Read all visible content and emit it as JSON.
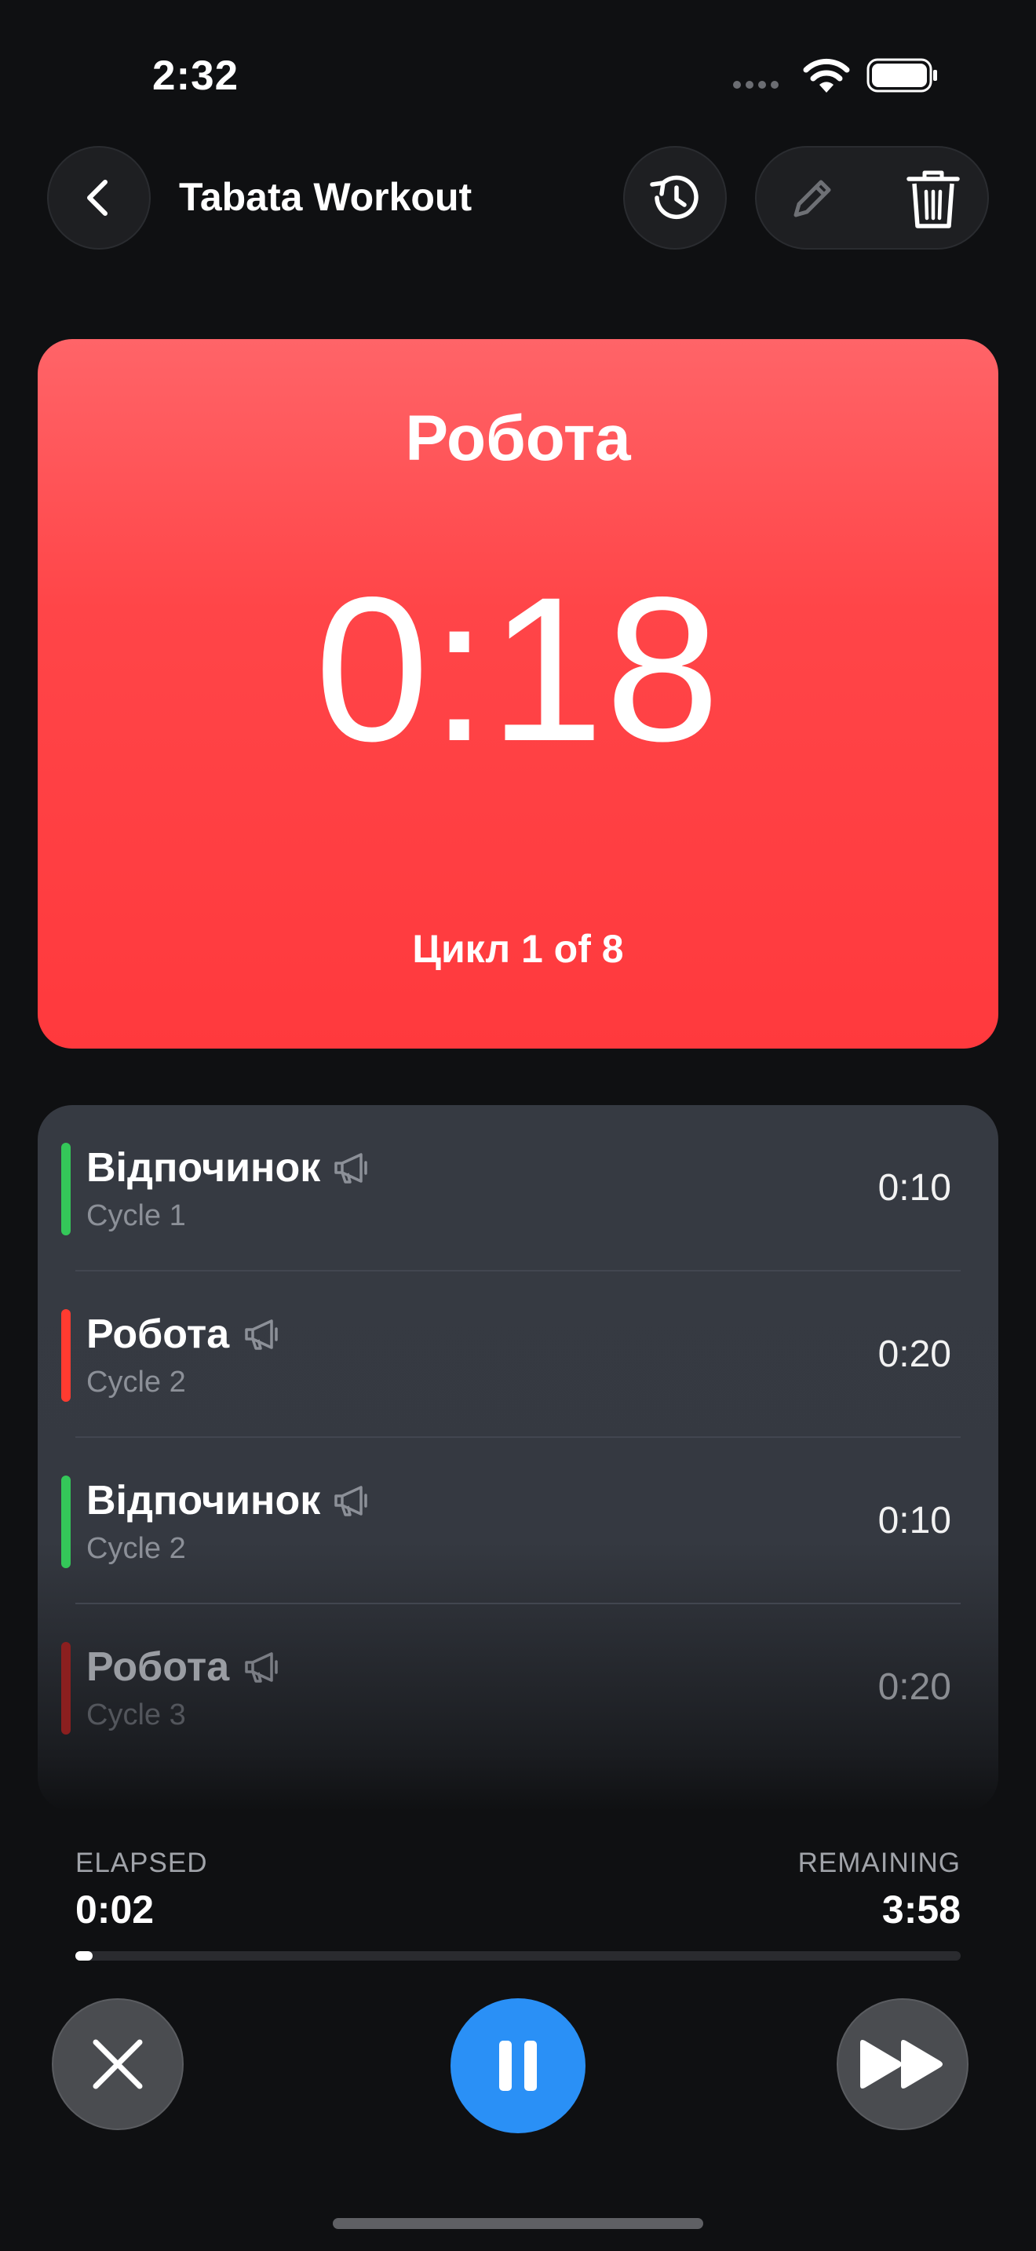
{
  "status_bar": {
    "time": "2:32"
  },
  "nav": {
    "title": "Tabata Workout"
  },
  "current": {
    "phase": "Робота",
    "time": "0:18",
    "cycle_text": "Цикл 1 of 8",
    "color": "#ff4044"
  },
  "intervals": [
    {
      "title": "Відпочинок",
      "subtitle": "Cycle 1",
      "time": "0:10",
      "color": "#34c759"
    },
    {
      "title": "Робота",
      "subtitle": "Cycle 2",
      "time": "0:20",
      "color": "#ff3b30"
    },
    {
      "title": "Відпочинок",
      "subtitle": "Cycle 2",
      "time": "0:10",
      "color": "#34c759"
    },
    {
      "title": "Робота",
      "subtitle": "Cycle 3",
      "time": "0:20",
      "color": "#8b1f1f"
    }
  ],
  "progress": {
    "elapsed_label": "ELAPSED",
    "elapsed": "0:02",
    "remaining_label": "REMAINING",
    "remaining": "3:58",
    "fraction": 0.008
  },
  "icons": {
    "back": "chevron-left-icon",
    "history": "history-icon",
    "edit": "pencil-icon",
    "delete": "trash-icon",
    "announce": "megaphone-icon",
    "stop": "close-icon",
    "pause": "pause-icon",
    "skip": "fast-forward-icon"
  },
  "colors": {
    "accent": "#2a90f6",
    "work": "#ff4044",
    "rest": "#34c759"
  }
}
